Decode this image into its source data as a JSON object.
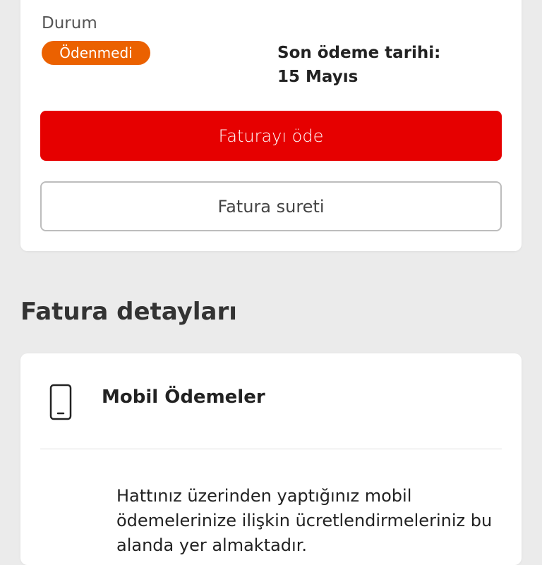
{
  "status": {
    "label": "Durum",
    "badge": "Ödenmedi",
    "badge_color": "#eb6100"
  },
  "due": {
    "label": "Son ödeme tarihi:",
    "date": "15 Mayıs"
  },
  "actions": {
    "pay_label": "Faturayı öde",
    "pay_color": "#e60000",
    "copy_label": "Fatura sureti"
  },
  "details": {
    "title": "Fatura detayları",
    "item": {
      "icon": "mobile-phone-icon",
      "title": "Mobil Ödemeler",
      "description": "Hattınız üzerinden yaptığınız mobil ödemelerinize ilişkin ücretlendirmeleriniz bu alanda yer almaktadır."
    }
  }
}
